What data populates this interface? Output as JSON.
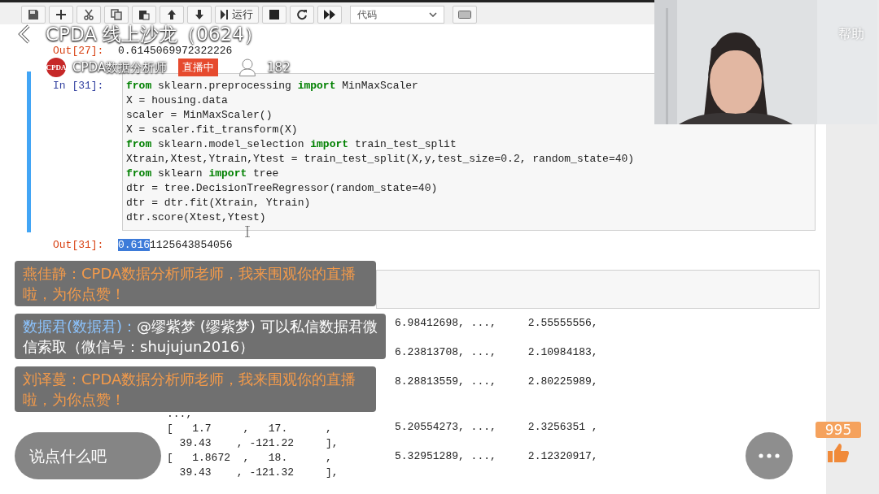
{
  "stream": {
    "title": "CPDA 线上沙龙（0624）",
    "host_logo": "CPDA",
    "host_name": "CPDA数据分析师",
    "live_badge": "直播中",
    "viewers": "182",
    "help": "帮助"
  },
  "notebook": {
    "toolbar": {
      "run_label": "运行",
      "cell_type": "代码"
    },
    "out27": {
      "prompt": "Out[27]:",
      "value": "0.6145069972322226"
    },
    "cell31": {
      "prompt": "In  [31]:",
      "selected": true,
      "lines": [
        "**from** sklearn.preprocessing **import** MinMaxScaler",
        "X = housing.data",
        "scaler = MinMaxScaler()",
        "X = scaler.fit_transform(X)",
        "**from** sklearn.model_selection **import** train_test_split",
        "Xtrain,Xtest,Ytrain,Ytest = train_test_split(X,y,test_size=0.2, random_state=40)",
        "**from** sklearn **import** tree",
        "dtr = tree.DecisionTreeRegressor(random_state=40)",
        "dtr = dtr.fit(Xtrain, Ytrain)",
        "dtr.score(Xtest,Ytest)"
      ]
    },
    "out31": {
      "prompt": "Out[31]:",
      "highlighted": "0.616",
      "value": "1125643854056"
    },
    "array_rows": [
      {
        "kind": "tail",
        "right": "6.98412698, ...,     2.55555556,"
      },
      {
        "kind": "tail",
        "right": "6.23813708, ...,     2.10984183,"
      },
      {
        "kind": "tail",
        "right": "8.28813559, ...,     2.80225989,"
      },
      {
        "kind": "cont",
        "left": "...,"
      },
      {
        "kind": "full",
        "left": "[   1.7     ,   17.      ,",
        "right": "5.20554273, ...,     2.3256351 ,"
      },
      {
        "kind": "cont",
        "left": "  39.43    , -121.22     ],"
      },
      {
        "kind": "full",
        "left": "[   1.8672  ,   18.      ,",
        "right": "5.32951289, ...,     2.12320917,"
      },
      {
        "kind": "cont",
        "left": "  39.43    , -121.32     ],"
      }
    ]
  },
  "comments": [
    {
      "kind": "greeting",
      "name": "燕佳静：",
      "text": "CPDA数据分析师老师，我来围观你的直播啦，为你点赞！"
    },
    {
      "kind": "reply",
      "name": "数据君(数据君)：",
      "text": "@缪紫梦 (缪紫梦) 可以私信数据君微信索取（微信号：shujujun2016）"
    },
    {
      "kind": "greeting",
      "name": "刘译蔓：",
      "text": "CPDA数据分析师老师，我来围观你的直播啦，为你点赞！"
    }
  ],
  "comment_input": {
    "placeholder": "说点什么吧"
  },
  "likes": "995"
}
